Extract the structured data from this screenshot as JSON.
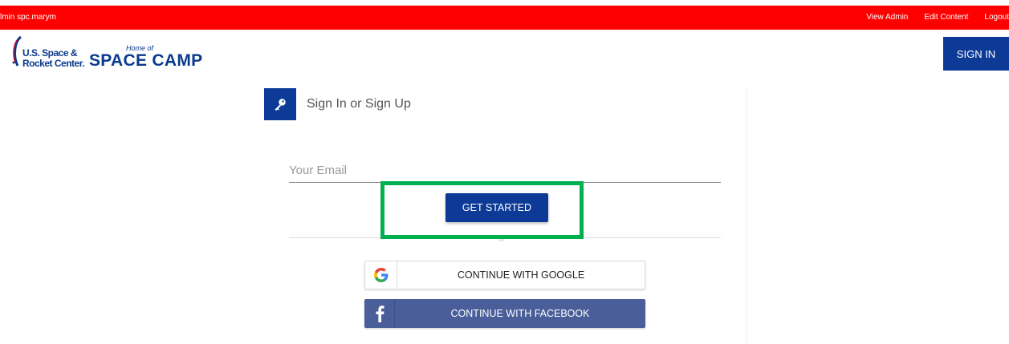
{
  "admin_bar": {
    "user_label": "lmin spc.marym",
    "links": [
      "View Admin",
      "Edit Content",
      "Logout"
    ],
    "color": "#ff0000"
  },
  "header": {
    "logo": {
      "line1": "U.S. Space &",
      "line2": "Rocket Center.",
      "home_of": "Home of",
      "brand": "SPACE CAMP"
    },
    "sign_in_label": "SIGN IN"
  },
  "signin_card": {
    "title": "Sign In or Sign Up",
    "title_icon": "key-icon",
    "email_placeholder": "Your Email",
    "email_value": "",
    "get_started_label": "GET STARTED",
    "divider_text": "or",
    "google_label": "CONTINUE WITH GOOGLE",
    "google_icon": "google-icon",
    "facebook_label": "CONTINUE WITH FACEBOOK",
    "facebook_icon": "facebook-icon"
  },
  "colors": {
    "primary": "#0c3a96",
    "highlight": "#00b04f",
    "facebook": "#4a5f9a"
  }
}
